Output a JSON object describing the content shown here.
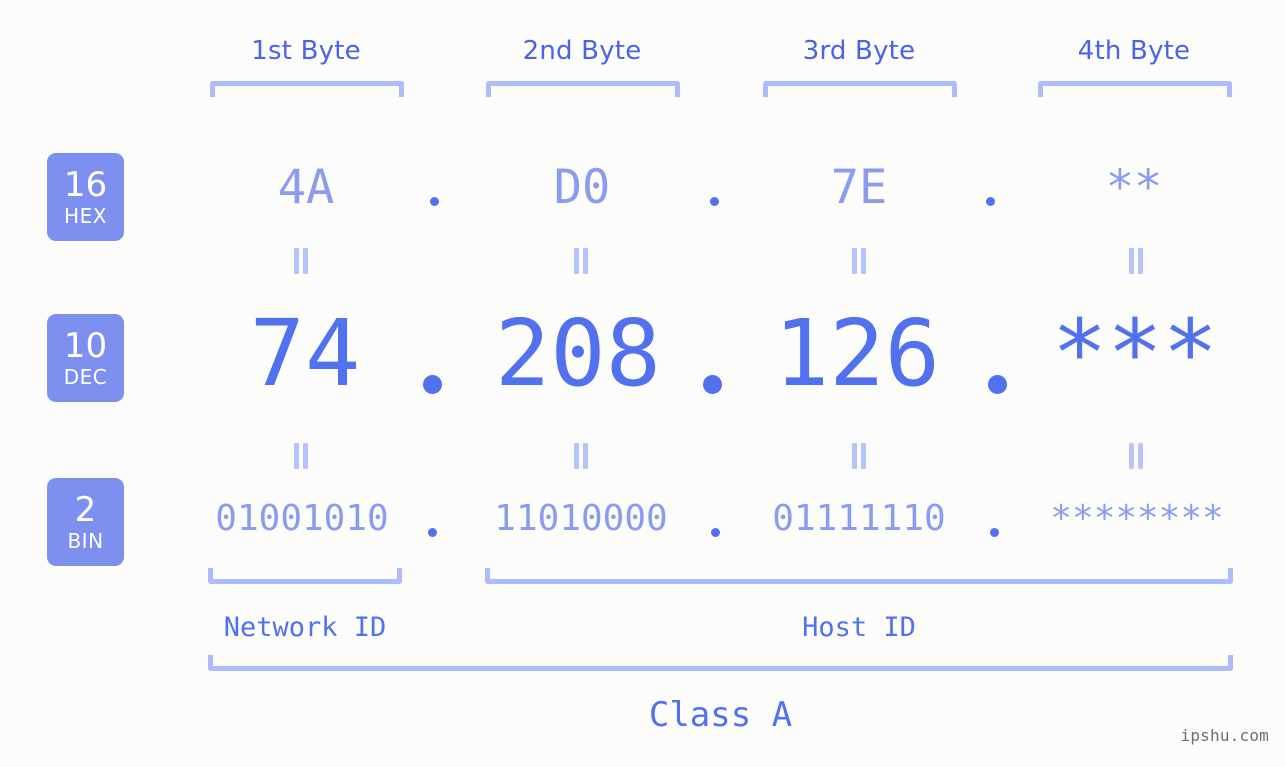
{
  "meta": {
    "background": "#fcfdfa",
    "accent_strong": "#5271ee",
    "accent_light": "#8b9cf0",
    "bracket_color": "#aebbfc",
    "badge_bg": "#7e90ef",
    "watermark": "ipshu.com"
  },
  "byte_headers": [
    {
      "label": "1st Byte"
    },
    {
      "label": "2nd Byte"
    },
    {
      "label": "3rd Byte"
    },
    {
      "label": "4th Byte"
    }
  ],
  "bases": [
    {
      "number": "16",
      "name": "HEX"
    },
    {
      "number": "10",
      "name": "DEC"
    },
    {
      "number": "2",
      "name": "BIN"
    }
  ],
  "rows": {
    "hex": {
      "base_number": "16",
      "base_name": "HEX",
      "octets": [
        "4A",
        "D0",
        "7E",
        "**"
      ],
      "separator": "."
    },
    "dec": {
      "base_number": "10",
      "base_name": "DEC",
      "octets": [
        "74",
        "208",
        "126",
        "***"
      ],
      "separator": "."
    },
    "bin": {
      "base_number": "2",
      "base_name": "BIN",
      "octets": [
        "01001010",
        "11010000",
        "01111110",
        "********"
      ],
      "separator": "."
    }
  },
  "equals_symbol": "=",
  "segments": {
    "network_id": "Network ID",
    "host_id": "Host ID",
    "class": "Class A"
  },
  "address": {
    "dec_full": "74.208.126.***",
    "hex_full": "4A.D0.7E.**",
    "bin_full": "01001010.11010000.01111110.********"
  }
}
